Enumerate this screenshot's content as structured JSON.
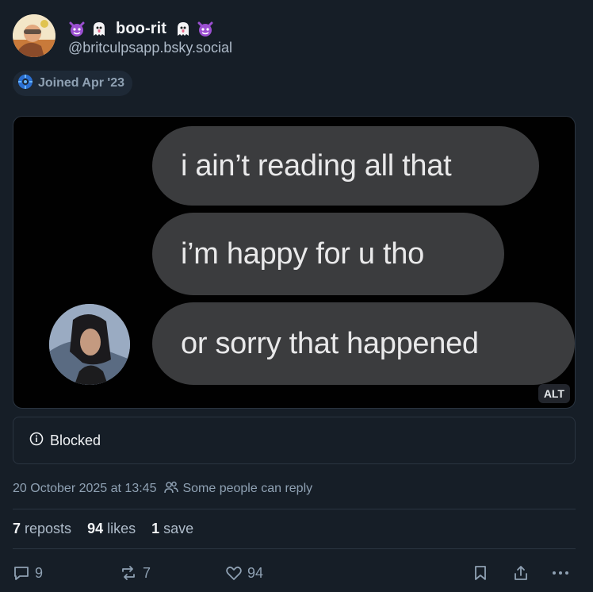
{
  "author": {
    "display_name": "boo-rit",
    "handle": "@britculpsapp.bsky.social",
    "name_emojis": [
      "devil-emoji",
      "ghost-emoji",
      "ghost-emoji",
      "devil-emoji"
    ]
  },
  "joined_badge": {
    "text": "Joined Apr '23"
  },
  "media": {
    "bubbles": [
      "i ain’t reading all that",
      "i’m happy for u tho",
      "or sorry that happened"
    ],
    "alt_label": "ALT"
  },
  "blocked": {
    "text": "Blocked"
  },
  "meta": {
    "timestamp": "20 October 2025 at 13:45",
    "reply_settings": "Some people can reply"
  },
  "stats": {
    "reposts_count": "7",
    "reposts_label": "reposts",
    "likes_count": "94",
    "likes_label": "likes",
    "saves_count": "1",
    "saves_label": "save"
  },
  "actions": {
    "reply_count": "9",
    "repost_count": "7",
    "like_count": "94"
  },
  "colors": {
    "background": "#161e27",
    "text": "#f1f3f5",
    "muted": "#8fa1b3",
    "border": "#2a3440",
    "badge_bg": "#1e2936"
  }
}
